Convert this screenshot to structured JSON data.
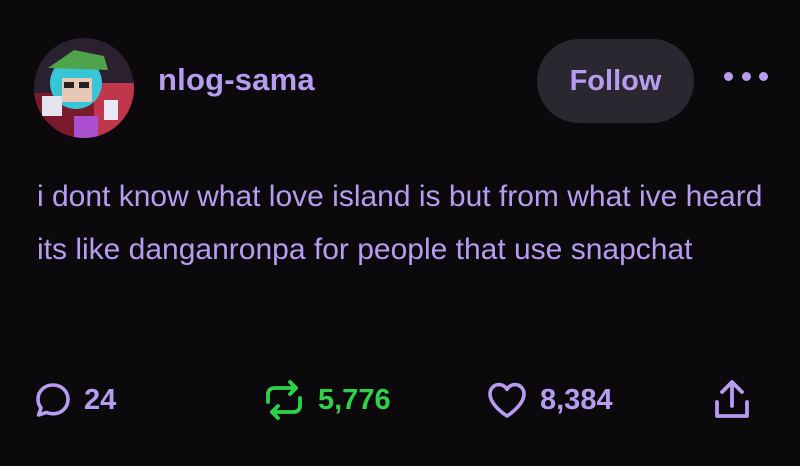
{
  "post": {
    "username": "nlog-sama",
    "follow_label": "Follow",
    "text": "i dont know what love island is but from what ive heard its like danganronpa for people that use snapchat",
    "replies": "24",
    "reblogs": "5,776",
    "likes": "8,384"
  },
  "icons": {
    "reply": "speech-bubble-icon",
    "reblog": "reblog-arrows-icon",
    "like": "heart-icon",
    "share": "share-upload-icon",
    "more": "ellipsis-icon"
  },
  "colors": {
    "background": "#0b090c",
    "accent": "#b79cf0",
    "reblog": "#2fd247",
    "button_bg": "#2a2730"
  }
}
